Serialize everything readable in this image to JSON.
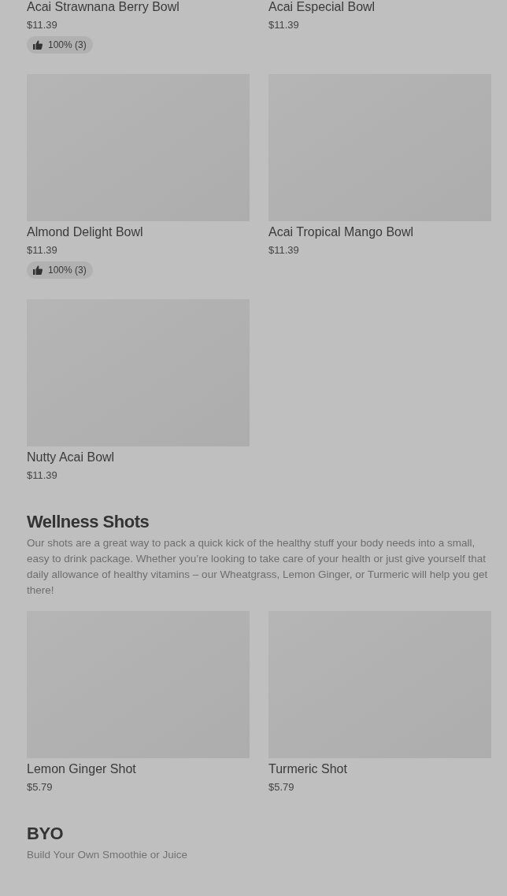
{
  "sections": [
    {
      "items": [
        {
          "name": "Acai Strawnana Berry Bowl",
          "price": "$11.39",
          "rating": "100% (3)"
        },
        {
          "name": "Acai Especial Bowl",
          "price": "$11.39"
        },
        {
          "name": "Almond Delight Bowl",
          "price": "$11.39",
          "rating": "100% (3)",
          "image": true
        },
        {
          "name": "Acai Tropical Mango Bowl",
          "price": "$11.39",
          "image": true
        },
        {
          "name": "Nutty Acai Bowl",
          "price": "$11.39",
          "image": true
        }
      ]
    },
    {
      "title": "Wellness Shots",
      "description": "Our shots are a great way to pack a quick kick of the healthy stuff your body needs into a small, easy to drink package. Whether you’re looking to take care of your health or just give yourself that daily allowance of healthy vitamins – our Wheatgrass, Lemon Ginger, or Turmeric will help you get there!",
      "items": [
        {
          "name": "Lemon Ginger Shot",
          "price": "$5.79",
          "image": true
        },
        {
          "name": "Turmeric Shot",
          "price": "$5.79",
          "image": true
        }
      ]
    },
    {
      "title": "BYO",
      "description": "Build Your Own Smoothie or Juice"
    }
  ]
}
